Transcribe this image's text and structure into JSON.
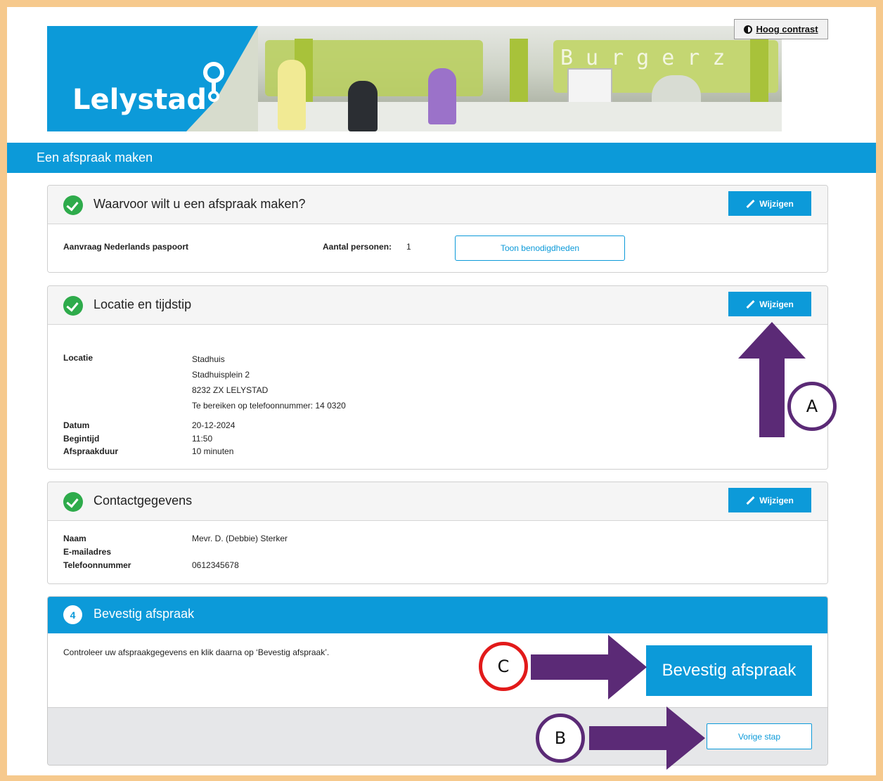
{
  "header": {
    "logo_text": "Lelystad",
    "photo_sign": "Burgerz",
    "contrast_label": "Hoog contrast"
  },
  "page": {
    "title": "Een afspraak maken"
  },
  "colors": {
    "brand_blue": "#0c9ad9",
    "check_green": "#2eab4b",
    "annotation_purple": "#5b2a76",
    "annotation_red": "#e21a1a",
    "frame": "#f6c98d"
  },
  "step1": {
    "title": "Waarvoor wilt u een afspraak maken?",
    "edit_label": "Wijzigen",
    "product": "Aanvraag Nederlands paspoort",
    "persons_label": "Aantal personen:",
    "persons_value": "1",
    "requirements_button": "Toon benodigdheden"
  },
  "step2": {
    "title": "Locatie en tijdstip",
    "edit_label": "Wijzigen",
    "location_label": "Locatie",
    "location_lines": [
      "Stadhuis",
      "Stadhuisplein 2",
      "8232 ZX LELYSTAD",
      "Te bereiken op telefoonnummer: 14 0320"
    ],
    "date_label": "Datum",
    "date_value": "20-12-2024",
    "start_label": "Begintijd",
    "start_value": "11:50",
    "duration_label": "Afspraakduur",
    "duration_value": "10 minuten"
  },
  "step3": {
    "title": "Contactgegevens",
    "edit_label": "Wijzigen",
    "name_label": "Naam",
    "name_value": "Mevr. D. (Debbie) Sterker",
    "email_label": "E-mailadres",
    "email_value": "",
    "phone_label": "Telefoonnummer",
    "phone_value": "0612345678"
  },
  "step4": {
    "number": "4",
    "title": "Bevestig afspraak",
    "instruction": "Controleer uw afspraakgegevens en klik daarna op ‘Bevestig afspraak’.",
    "confirm_label": "Bevestig afspraak",
    "back_label": "Vorige stap"
  },
  "annotations": {
    "a": "A",
    "b": "B",
    "c": "C"
  }
}
